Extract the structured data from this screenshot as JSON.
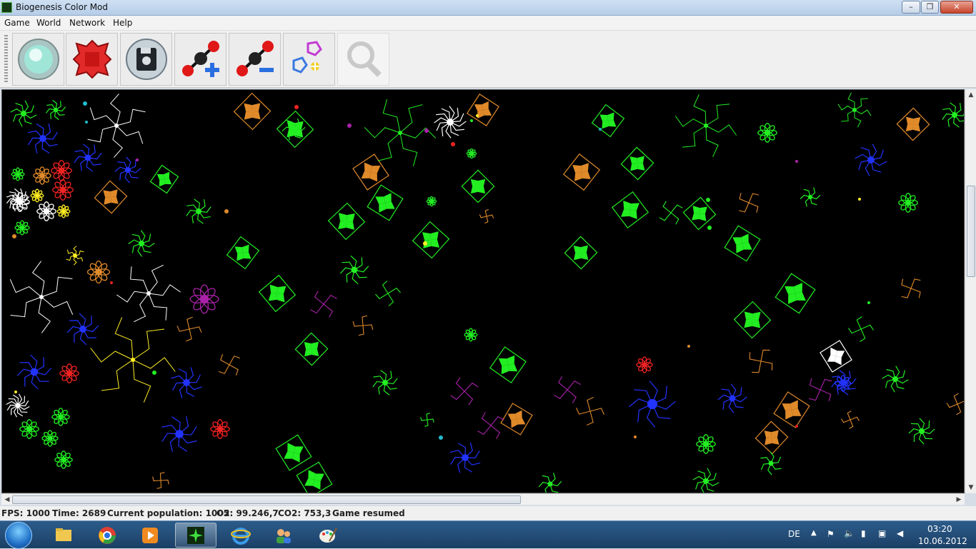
{
  "window": {
    "title": "Biogenesis Color Mod",
    "minimize": "–",
    "maximize": "❐",
    "close": "✕"
  },
  "menu": [
    "Game",
    "World",
    "Network",
    "Help"
  ],
  "toolbar": {
    "buttons": [
      {
        "name": "new-world",
        "icon": "globe-icon"
      },
      {
        "name": "open",
        "icon": "cell-icon"
      },
      {
        "name": "save",
        "icon": "disk-icon"
      },
      {
        "name": "increase-co2",
        "icon": "co2-plus-icon"
      },
      {
        "name": "decrease-co2",
        "icon": "co2-minus-icon"
      },
      {
        "name": "manipulate",
        "icon": "molecules-icon"
      },
      {
        "name": "examine",
        "icon": "magnifier-icon",
        "disabled": true
      }
    ]
  },
  "status": {
    "fps": "FPS: 1000",
    "time": "Time: 2689",
    "population": "Current population: 1005",
    "o2": "O2: 99.246,7",
    "co2": "CO2: 753,3",
    "state": "Game resumed"
  },
  "taskbar": {
    "apps": [
      "start-icon",
      "explorer-icon",
      "chrome-icon",
      "media-player-icon",
      "biogenesis-icon",
      "ie-icon",
      "contacts-icon",
      "paint-icon"
    ],
    "lang": "DE",
    "clock_time": "03:20",
    "clock_date": "10.06.2012"
  },
  "world": {
    "colors": {
      "green": "#22ee22",
      "orange": "#e08a2a",
      "blue": "#2233ff",
      "white": "#ffffff",
      "red": "#ee2222",
      "yellow": "#ffee22",
      "magenta": "#aa22aa",
      "cyan": "#22bbcc"
    }
  }
}
